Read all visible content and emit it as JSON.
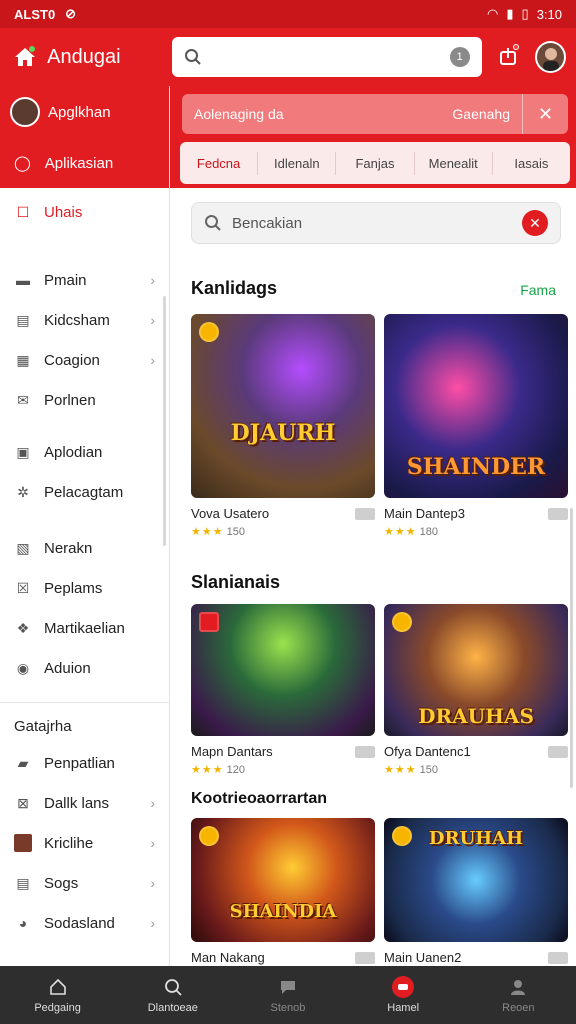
{
  "status_bar": {
    "carrier": "ALST0",
    "time": "3:10"
  },
  "appbar": {
    "title": "Andugai",
    "search_badge": "1"
  },
  "sidebar": {
    "profile_label": "Apglkhan",
    "app_label": "Aplikasian",
    "active_item": "Uhais",
    "items": [
      {
        "label": "Pmain",
        "icon": "controller-icon",
        "chevron": true
      },
      {
        "label": "Kidcsham",
        "icon": "book-icon",
        "chevron": true
      },
      {
        "label": "Coagion",
        "icon": "grid-icon",
        "chevron": true
      },
      {
        "label": "Porlnen",
        "icon": "mail-icon",
        "chevron": false
      },
      {
        "label": "Aplodian",
        "icon": "lock-icon",
        "chevron": false
      },
      {
        "label": "Pelacagtam",
        "icon": "puzzle-icon",
        "chevron": false
      },
      {
        "label": "Nerakn",
        "icon": "chart-icon",
        "chevron": false
      },
      {
        "label": "Peplams",
        "icon": "cross-icon",
        "chevron": false
      },
      {
        "label": "Martikaelian",
        "icon": "diamond-icon",
        "chevron": false
      },
      {
        "label": "Aduion",
        "icon": "target-icon",
        "chevron": false
      }
    ],
    "section_label": "Gatajrha",
    "section_items": [
      {
        "label": "Penpatlian",
        "icon": "car-icon",
        "chevron": false
      },
      {
        "label": "Dallk lans",
        "icon": "tag-icon",
        "chevron": true
      },
      {
        "label": "Kriclihe",
        "icon": "photo-icon",
        "chevron": true
      },
      {
        "label": "Sogs",
        "icon": "list-icon",
        "chevron": true
      },
      {
        "label": "Sodasland",
        "icon": "circle-icon",
        "chevron": true
      }
    ]
  },
  "subheader": {
    "search_text": "Aolenaging da",
    "search_right": "Gaenahg",
    "tabs": [
      "Fedcna",
      "Idlenaln",
      "Fanjas",
      "Menealit",
      "Iasais"
    ]
  },
  "main": {
    "search_placeholder": "Bencakian",
    "sections": [
      {
        "title": "Kanlidags",
        "link": "Fama",
        "cards": [
          {
            "name": "Vova Usatero",
            "rating": "150",
            "art": "DJAURH"
          },
          {
            "name": "Main Dantep3",
            "rating": "180",
            "art": "SHAINDER"
          }
        ]
      },
      {
        "title": "Slanianais",
        "link": "",
        "cards": [
          {
            "name": "Mapn Dantars",
            "rating": "120",
            "art": ""
          },
          {
            "name": "Ofya Dantenc1",
            "rating": "150",
            "art": "DRAUHAS"
          }
        ]
      },
      {
        "title": "Kootrieoaorrartan",
        "link": "",
        "cards": [
          {
            "name": "Man Nakang",
            "rating": "",
            "art": "SHAINDIA"
          },
          {
            "name": "Main Uanen2",
            "rating": "",
            "art": "DRUHAH"
          }
        ]
      }
    ]
  },
  "bottom_nav": [
    {
      "label": "Pedgaing",
      "icon": "home-outline-icon",
      "state": "normal"
    },
    {
      "label": "Dlantoeae",
      "icon": "search-icon",
      "state": "normal"
    },
    {
      "label": "Stenob",
      "icon": "chat-icon",
      "state": "dim"
    },
    {
      "label": "Hamel",
      "icon": "game-icon",
      "state": "active"
    },
    {
      "label": "Reoen",
      "icon": "profile-icon",
      "state": "dim"
    }
  ],
  "colors": {
    "brand_red": "#e21d22",
    "link_green": "#1aa34a",
    "star_gold": "#f0b400"
  }
}
